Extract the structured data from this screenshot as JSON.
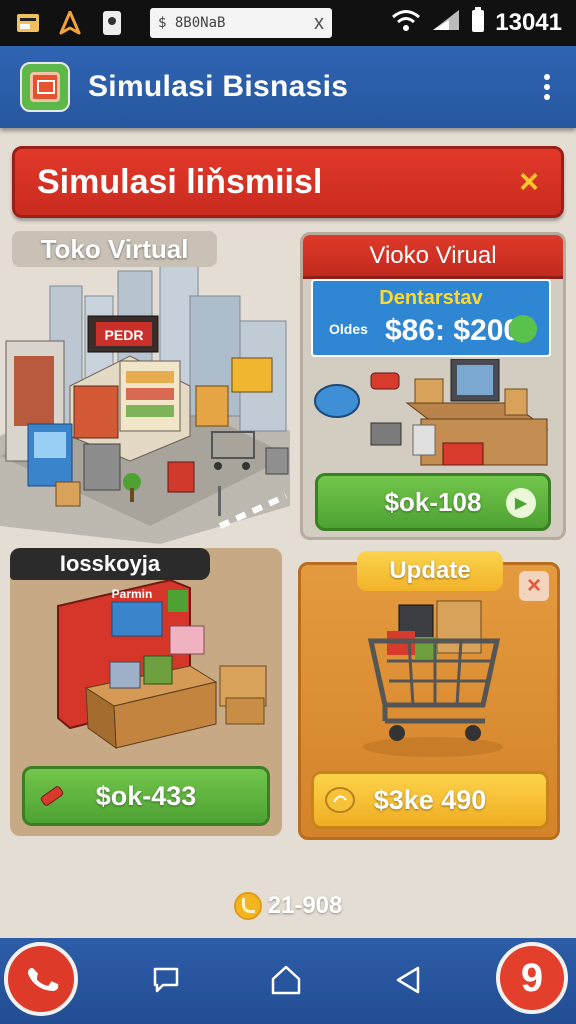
{
  "status_bar": {
    "search_text": "$ 8B0NaB",
    "close_symbol": "x",
    "time": "13041"
  },
  "app_bar": {
    "title": "Simulasi Bisnasis"
  },
  "banner": {
    "title": "Simulasi liňsmiisl",
    "close_symbol": "×"
  },
  "city_card": {
    "label": "Toko Virtual",
    "sign": "PEDR"
  },
  "shop_card": {
    "header": "Vioko Virual",
    "info_label": "Dentarstav",
    "info_sub": "Oldes",
    "info_value": "$86: $200",
    "button_label": "$ok-108"
  },
  "store_card": {
    "label": "Iosskoyja",
    "sign": "Parmin",
    "button_label": "$ok-433"
  },
  "update_card": {
    "tab_label": "Update",
    "close_symbol": "×",
    "button_label": "$3ke 490"
  },
  "footer": {
    "coins": "21-908"
  },
  "nav": {
    "right_badge": "9"
  },
  "colors": {
    "app_bar": "#2f64b3",
    "banner": "#e2392a",
    "green_button": "#5cb33d",
    "orange_card": "#e09338",
    "yellow_button": "#f6c236"
  }
}
